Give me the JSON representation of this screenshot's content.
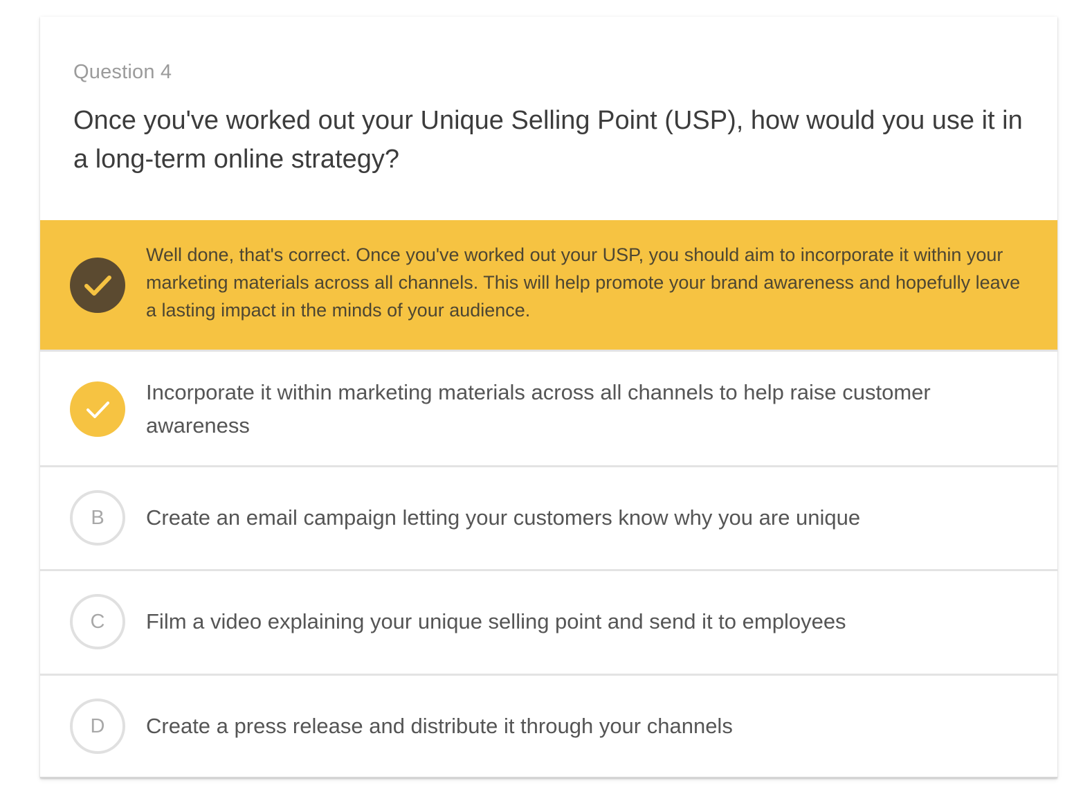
{
  "question": {
    "number_label": "Question 4",
    "text": "Once you've worked out your Unique Selling Point (USP), how would you use it in a long-term online strategy?"
  },
  "feedback": {
    "status": "correct",
    "text": "Well done, that's correct. Once you've worked out your USP, you should aim to incorporate it within your marketing materials across all channels. This will help promote your brand awareness and hopefully leave a lasting impact in the minds of your audience.",
    "icon": "check-circle-icon"
  },
  "options": [
    {
      "letter": "A",
      "text": "Incorporate it within marketing materials across all channels to help raise customer awareness",
      "selected": true,
      "correct": true,
      "icon": "check-icon"
    },
    {
      "letter": "B",
      "text": "Create an email campaign letting your customers know why you are unique",
      "selected": false,
      "correct": false
    },
    {
      "letter": "C",
      "text": "Film a video explaining your unique selling point and send it to employees",
      "selected": false,
      "correct": false
    },
    {
      "letter": "D",
      "text": "Create a press release and distribute it through your channels",
      "selected": false,
      "correct": false
    }
  ],
  "colors": {
    "accent_yellow": "#f6c342",
    "feedback_icon_bg": "#5b4a30",
    "text_dark": "#3c3c3c",
    "text_muted": "#9b9b9b",
    "divider": "#e3e3e3"
  }
}
